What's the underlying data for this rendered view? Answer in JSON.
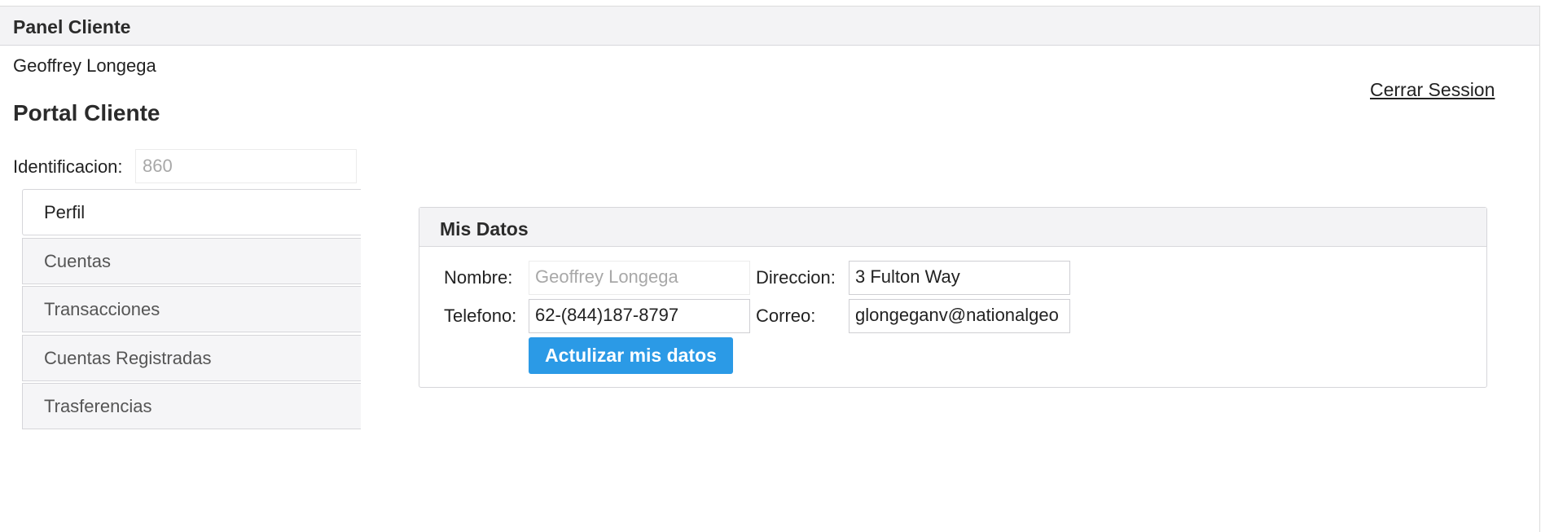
{
  "panel": {
    "title": "Panel Cliente"
  },
  "user": {
    "name": "Geoffrey Longega"
  },
  "logout": {
    "label": "Cerrar Session"
  },
  "portal": {
    "title": "Portal Cliente",
    "id_label": "Identificacion:",
    "id_value": "860"
  },
  "nav": {
    "items": [
      {
        "label": "Perfil",
        "active": true
      },
      {
        "label": "Cuentas",
        "active": false
      },
      {
        "label": "Transacciones",
        "active": false
      },
      {
        "label": "Cuentas Registradas",
        "active": false
      },
      {
        "label": "Trasferencias",
        "active": false
      }
    ]
  },
  "profile": {
    "title": "Mis Datos",
    "nombre_label": "Nombre:",
    "nombre_value": "Geoffrey Longega",
    "direccion_label": "Direccion:",
    "direccion_value": "3 Fulton Way",
    "telefono_label": "Telefono:",
    "telefono_value": "62-(844)187-8797",
    "correo_label": "Correo:",
    "correo_value": "glongeganv@nationalgeo",
    "update_button": "Actulizar mis datos"
  },
  "colors": {
    "primary_button": "#2b9ae6",
    "header_bg": "#f3f3f5",
    "nav_bg": "#f5f5f7"
  }
}
